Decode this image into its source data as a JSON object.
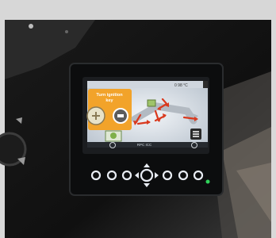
{
  "screen": {
    "status_left": "",
    "status_right": "0 98 °C",
    "warning_line1": "Turn ignition",
    "warning_line2": "key",
    "bottom_status": "RPC ICC",
    "menu_icon": "menu-icon",
    "ignition_icon": "ignition-key-icon",
    "machine_icon": "excavator-arm-icon"
  },
  "colors": {
    "frame": "#111314",
    "screen_bg": "#dfe5ec",
    "warning_bg": "#f2a32a",
    "arrow_red": "#d93a1f",
    "bezel_led_green": "#2fd35a",
    "button_ring": "#e8ecf3"
  },
  "panel_buttons": {
    "count": 7,
    "center": "navigation-diamond"
  }
}
